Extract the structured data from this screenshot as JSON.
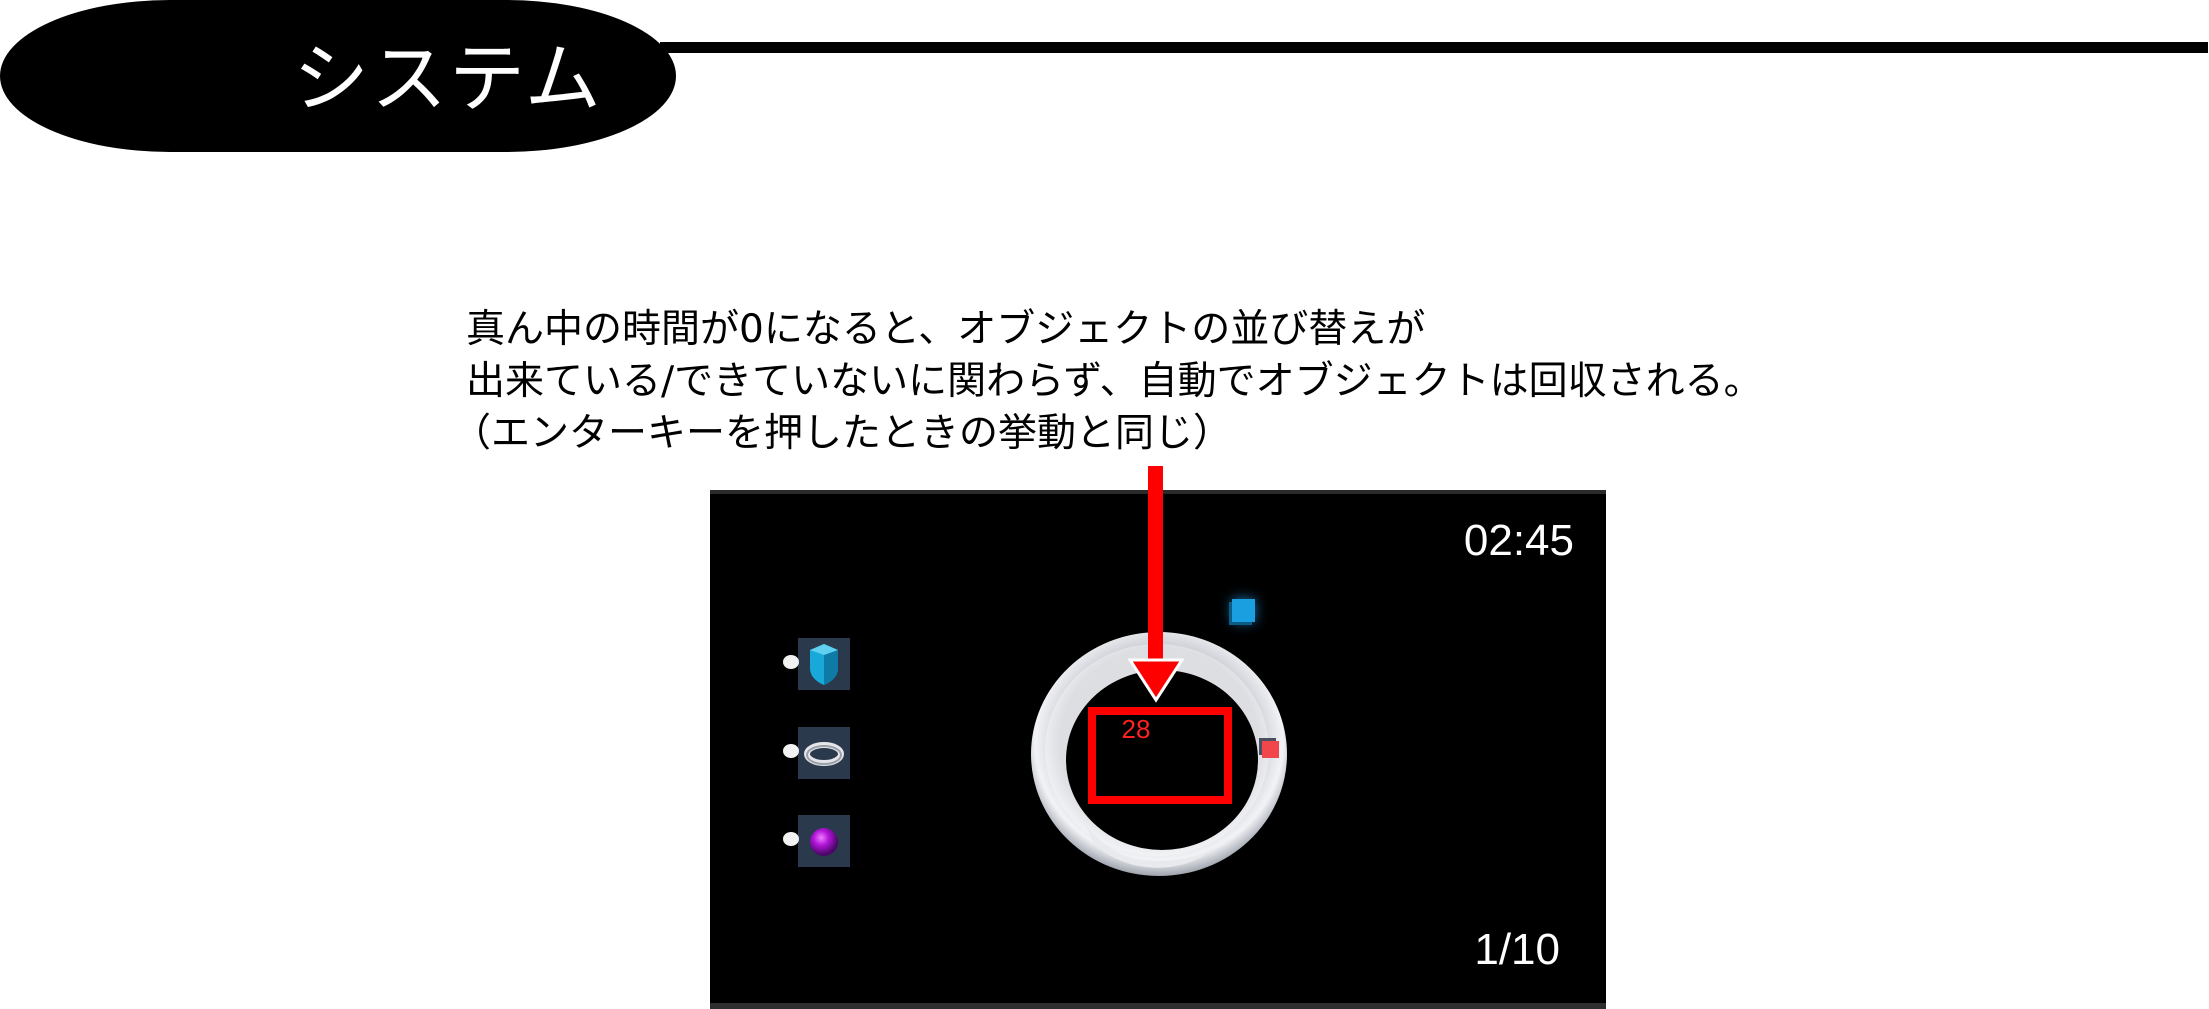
{
  "header": {
    "title": "システム"
  },
  "description": {
    "lines": [
      "真ん中の時間が0になると、オブジェクトの並び替えが",
      "出来ている/できていないに関わらず、自動でオブジェクトは回収される。",
      "（エンターキーを押したときの挙動と同じ）"
    ]
  },
  "game": {
    "timer": "02:45",
    "page_count": "1/10",
    "center_counter": "28",
    "inventory": [
      {
        "icon": "cyan-shield-icon"
      },
      {
        "icon": "silver-ring-icon"
      },
      {
        "icon": "purple-orb-icon"
      }
    ]
  },
  "colors": {
    "highlight": "#ff0000",
    "game_background": "#000000",
    "counter_text": "#ff2020"
  }
}
